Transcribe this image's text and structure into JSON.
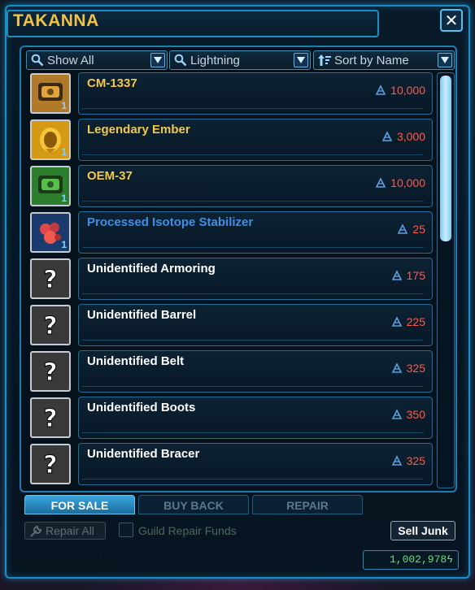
{
  "window": {
    "title": "TAKANNA",
    "close_glyph": "✕"
  },
  "filters": {
    "category": {
      "label": "Show All",
      "icon": "search-icon"
    },
    "search": {
      "label": "Lightning",
      "icon": "search-icon"
    },
    "sort": {
      "label": "Sort by Name",
      "icon": "sort-icon"
    }
  },
  "items": [
    {
      "name": "CM-1337",
      "price": "10,000",
      "qty": "1",
      "name_color": "#f4c84a",
      "thumb_bg": "#b07a2a",
      "icon": "cartel-pack-icon"
    },
    {
      "name": "Legendary Ember",
      "price": "3,000",
      "qty": "1",
      "name_color": "#f4c84a",
      "thumb_bg": "#d49a16",
      "icon": "ember-icon"
    },
    {
      "name": "OEM-37",
      "price": "10,000",
      "qty": "1",
      "name_color": "#f4c84a",
      "thumb_bg": "#2d7d2f",
      "icon": "green-pack-icon"
    },
    {
      "name": "Processed Isotope Stabilizer",
      "price": "25",
      "qty": "1",
      "name_color": "#3f8fe6",
      "thumb_bg": "#1b3a6e",
      "icon": "isotope-icon"
    },
    {
      "name": "Unidentified Armoring",
      "price": "175",
      "qty": "",
      "name_color": "#ffffff",
      "thumb_bg": "#3a3a3a",
      "icon": "unknown-armoring-icon"
    },
    {
      "name": "Unidentified Barrel",
      "price": "225",
      "qty": "",
      "name_color": "#ffffff",
      "thumb_bg": "#3a3a3a",
      "icon": "unknown-barrel-icon"
    },
    {
      "name": "Unidentified Belt",
      "price": "325",
      "qty": "",
      "name_color": "#ffffff",
      "thumb_bg": "#3a3a3a",
      "icon": "unknown-belt-icon"
    },
    {
      "name": "Unidentified Boots",
      "price": "350",
      "qty": "",
      "name_color": "#ffffff",
      "thumb_bg": "#3a3a3a",
      "icon": "unknown-boots-icon"
    },
    {
      "name": "Unidentified Bracer",
      "price": "325",
      "qty": "",
      "name_color": "#ffffff",
      "thumb_bg": "#3a3a3a",
      "icon": "unknown-bracer-icon"
    }
  ],
  "tabs": [
    {
      "label": "FOR SALE",
      "active": true
    },
    {
      "label": "BUY BACK",
      "active": false
    },
    {
      "label": "REPAIR",
      "active": false
    }
  ],
  "footer": {
    "repair_all_label": "Repair All",
    "guild_repair_label": "Guild Repair Funds",
    "sell_junk_label": "Sell Junk",
    "credits": "1,002,978"
  },
  "colors": {
    "accent": "#1a8fc7",
    "price": "#ff5a4a",
    "credits": "#66e07a",
    "title": "#f0c24a"
  }
}
